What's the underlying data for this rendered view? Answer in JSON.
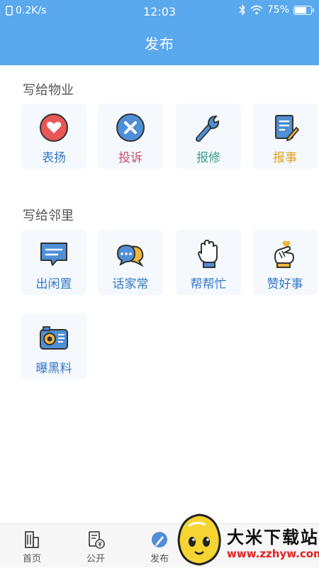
{
  "status_bar": {
    "speed": "0.2K/s",
    "time": "12:03",
    "battery": "75%",
    "battery_level": 0.75
  },
  "header": {
    "title": "发布"
  },
  "section_property": {
    "title": "写给物业",
    "items": [
      {
        "label": "表扬",
        "icon": "heart-icon",
        "color": "#3478c8"
      },
      {
        "label": "投诉",
        "icon": "x-circle-icon",
        "color": "#d04a6a"
      },
      {
        "label": "报修",
        "icon": "wrench-icon",
        "color": "#3f9b8e"
      },
      {
        "label": "报事",
        "icon": "notepad-icon",
        "color": "#e0a020"
      }
    ]
  },
  "section_neighbor": {
    "title": "写给邻里",
    "items": [
      {
        "label": "出闲置",
        "icon": "message-icon",
        "color": "#3478c8"
      },
      {
        "label": "话家常",
        "icon": "chat-bubbles-icon",
        "color": "#3478c8"
      },
      {
        "label": "帮帮忙",
        "icon": "hand-icon",
        "color": "#3478c8"
      },
      {
        "label": "赞好事",
        "icon": "thumbs-heart-icon",
        "color": "#3478c8"
      },
      {
        "label": "曝黑料",
        "icon": "camera-icon",
        "color": "#3478c8"
      }
    ]
  },
  "tab_bar": {
    "tabs": [
      {
        "label": "首页",
        "icon": "building-icon"
      },
      {
        "label": "公开",
        "icon": "document-yen-icon"
      },
      {
        "label": "发布",
        "icon": "pen-icon"
      }
    ]
  },
  "watermark": {
    "title": "大米下载站",
    "url": "www.zzhyw.com"
  }
}
